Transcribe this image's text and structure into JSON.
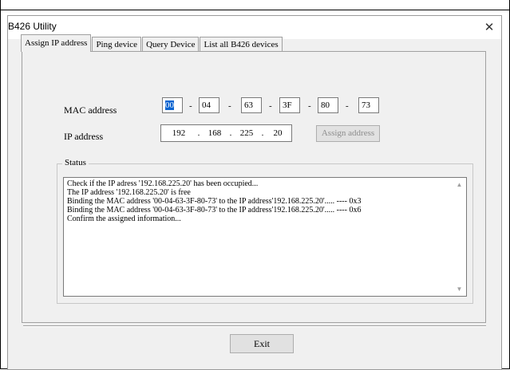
{
  "window": {
    "title": "B426 Utility",
    "close_glyph": "✕"
  },
  "tabs": [
    {
      "label": "Assign IP address",
      "active": true
    },
    {
      "label": "Ping device",
      "active": false
    },
    {
      "label": "Query Device",
      "active": false
    },
    {
      "label": "List all B426 devices",
      "active": false
    }
  ],
  "form": {
    "mac_label": "MAC address",
    "mac_octets": [
      "00",
      "04",
      "63",
      "3F",
      "80",
      "73"
    ],
    "mac_separator": "-",
    "ip_label": "IP address",
    "ip_octets": [
      "192",
      "168",
      "225",
      "20"
    ],
    "ip_separator": ".",
    "assign_button": "Assign address"
  },
  "status": {
    "legend": "Status",
    "lines": [
      "Check if the IP adress '192.168.225.20' has been occupied...",
      "The IP address '192.168.225.20' is free",
      "Binding the MAC address '00-04-63-3F-80-73' to the IP address'192.168.225.20'..... ---- 0x3",
      "Binding the MAC address '00-04-63-3F-80-73' to the IP address'192.168.225.20'..... ---- 0x6",
      "Confirm the assigned information..."
    ]
  },
  "exit_button": "Exit",
  "colors": {
    "selection": "#0a64d0",
    "dialog_bg": "#f0f0f0",
    "disabled_text": "#8d8d8d"
  }
}
